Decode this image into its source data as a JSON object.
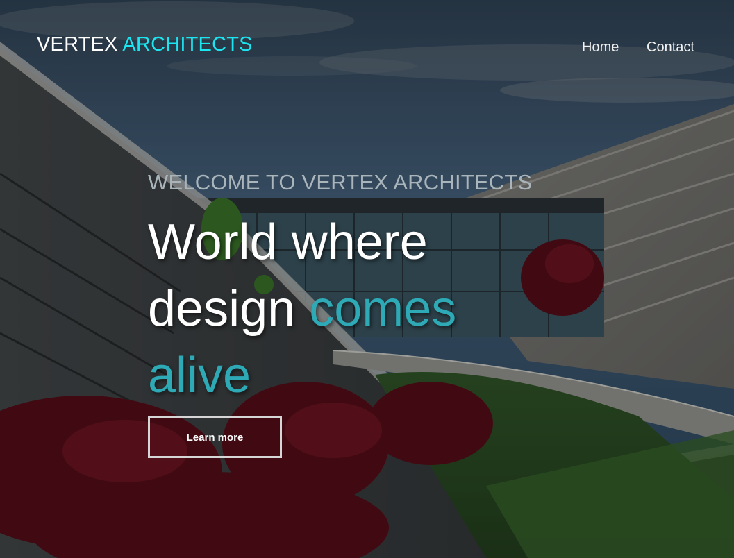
{
  "brand": {
    "primary": "VERTEX",
    "accent": "ARCHITECTS",
    "accent_color": "#1be5f0"
  },
  "nav": {
    "items": [
      {
        "label": "Home"
      },
      {
        "label": "Contact"
      }
    ]
  },
  "hero": {
    "eyebrow": "WELCOME TO VERTEX ARCHITECTS",
    "headline_plain": "World where design",
    "headline_accent": "comes alive",
    "headline_accent_color": "#2eaab7",
    "cta_label": "Learn more",
    "background_image": "modern-building-with-curved-roof-and-red-trees"
  }
}
